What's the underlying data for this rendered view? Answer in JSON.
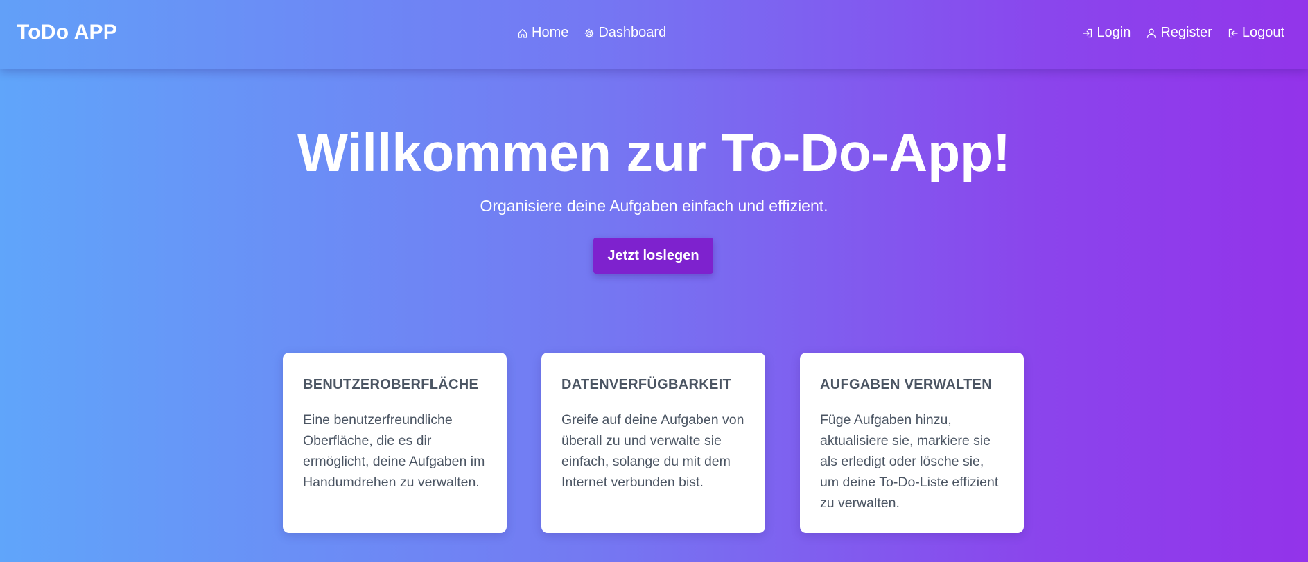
{
  "nav": {
    "brand": "ToDo APP",
    "center_links": [
      {
        "label": "Home",
        "icon": "home-icon"
      },
      {
        "label": "Dashboard",
        "icon": "gear-icon"
      }
    ],
    "right_links": [
      {
        "label": "Login",
        "icon": "login-icon"
      },
      {
        "label": "Register",
        "icon": "user-icon"
      },
      {
        "label": "Logout",
        "icon": "logout-icon"
      }
    ]
  },
  "hero": {
    "title": "Willkommen zur To-Do-App!",
    "subtitle": "Organisiere deine Aufgaben einfach und effizient.",
    "cta_label": "Jetzt loslegen"
  },
  "cards": [
    {
      "title": "BENUTZEROBERFLÄCHE",
      "text": "Eine benutzerfreundliche Oberfläche, die es dir ermöglicht, deine Aufgaben im Handumdrehen zu verwalten."
    },
    {
      "title": "DATENVERFÜGBARKEIT",
      "text": "Greife auf deine Aufgaben von überall zu und verwalte sie einfach, solange du mit dem Internet verbunden bist."
    },
    {
      "title": "AUFGABEN VERWALTEN",
      "text": "Füge Aufgaben hinzu, aktualisiere sie, markiere sie als erledigt oder lösche sie, um deine To-Do-Liste effizient zu verwalten."
    }
  ],
  "colors": {
    "gradient_start": "#60a5fa",
    "gradient_end": "#9333ea",
    "cta_background": "#7e22ce",
    "card_text": "#4b5563"
  }
}
